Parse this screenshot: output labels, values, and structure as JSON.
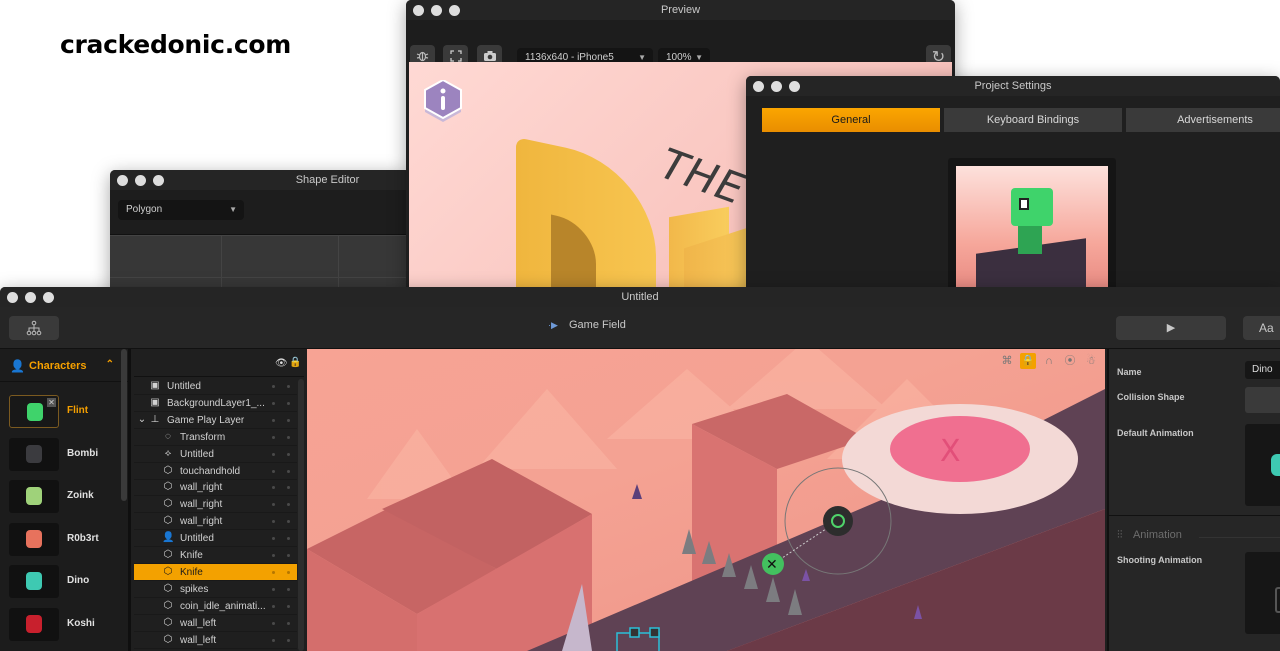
{
  "watermark": "crackedonic.com",
  "shape_editor": {
    "title": "Shape Editor",
    "shape_type": "Polygon"
  },
  "preview": {
    "title": "Preview",
    "resolution": "1136x640 - iPhone5",
    "zoom": "100%",
    "scene_text": "THE",
    "tools": [
      "bug-icon",
      "fullscreen-icon",
      "camera-icon"
    ],
    "refresh_icon": "↻"
  },
  "project_settings": {
    "title": "Project Settings",
    "tabs": [
      {
        "label": "General",
        "active": true
      },
      {
        "label": "Keyboard Bindings",
        "active": false
      },
      {
        "label": "Advertisements",
        "active": false
      }
    ]
  },
  "main": {
    "title": "Untitled",
    "breadcrumb": "Game Field",
    "play_icon": "▶",
    "font_button": "Aa",
    "characters": {
      "header": "Characters",
      "items": [
        {
          "name": "Flint",
          "selected": true,
          "color": "#3fd36b"
        },
        {
          "name": "Bombi",
          "selected": false,
          "color": "#3b3b3f"
        },
        {
          "name": "Zoink",
          "selected": false,
          "color": "#9fd27a"
        },
        {
          "name": "R0b3rt",
          "selected": false,
          "color": "#e7725d"
        },
        {
          "name": "Dino",
          "selected": false,
          "color": "#3ec9b2"
        },
        {
          "name": "Koshi",
          "selected": false,
          "color": "#c8202d"
        }
      ]
    },
    "layers": [
      {
        "name": "Untitled",
        "icon": "image-layer",
        "indent": 0,
        "selected": false
      },
      {
        "name": "BackgroundLayer1_...",
        "icon": "image-layer",
        "indent": 0,
        "selected": false
      },
      {
        "name": "Game Play Layer",
        "icon": "actor-layer",
        "indent": 0,
        "expanded": true,
        "selected": false
      },
      {
        "name": "Transform",
        "icon": "transform",
        "indent": 1,
        "selected": false
      },
      {
        "name": "Untitled",
        "icon": "path",
        "indent": 1,
        "selected": false
      },
      {
        "name": "touchandhold",
        "icon": "hexagon",
        "indent": 1,
        "selected": false
      },
      {
        "name": "wall_right",
        "icon": "hexagon",
        "indent": 1,
        "selected": false
      },
      {
        "name": "wall_right",
        "icon": "hexagon",
        "indent": 1,
        "selected": false
      },
      {
        "name": "wall_right",
        "icon": "hexagon",
        "indent": 1,
        "selected": false
      },
      {
        "name": "Untitled",
        "icon": "actor",
        "indent": 1,
        "selected": false
      },
      {
        "name": "Knife",
        "icon": "hexagon",
        "indent": 1,
        "selected": false
      },
      {
        "name": "Knife",
        "icon": "hexagon",
        "indent": 1,
        "selected": true
      },
      {
        "name": "spikes",
        "icon": "hexagon",
        "indent": 1,
        "selected": false
      },
      {
        "name": "coin_idle_animati...",
        "icon": "hexagon",
        "indent": 1,
        "selected": false
      },
      {
        "name": "wall_left",
        "icon": "hexagon",
        "indent": 1,
        "selected": false
      },
      {
        "name": "wall_left",
        "icon": "hexagon",
        "indent": 1,
        "selected": false
      }
    ],
    "canvas_tools": [
      {
        "name": "connect-icon",
        "glyph": "⌘",
        "active": false
      },
      {
        "name": "lock-icon",
        "glyph": "🔒",
        "active": true
      },
      {
        "name": "magnet-icon",
        "glyph": "∩",
        "active": false
      },
      {
        "name": "link-icon",
        "glyph": "⦿",
        "active": false
      },
      {
        "name": "bug-icon",
        "glyph": "☃",
        "active": false
      }
    ],
    "properties": {
      "name_label": "Name",
      "name_value": "Dino",
      "collision_label": "Collision Shape",
      "default_anim_label": "Default Animation",
      "section": "Animation",
      "shooting_label": "Shooting Animation"
    }
  }
}
